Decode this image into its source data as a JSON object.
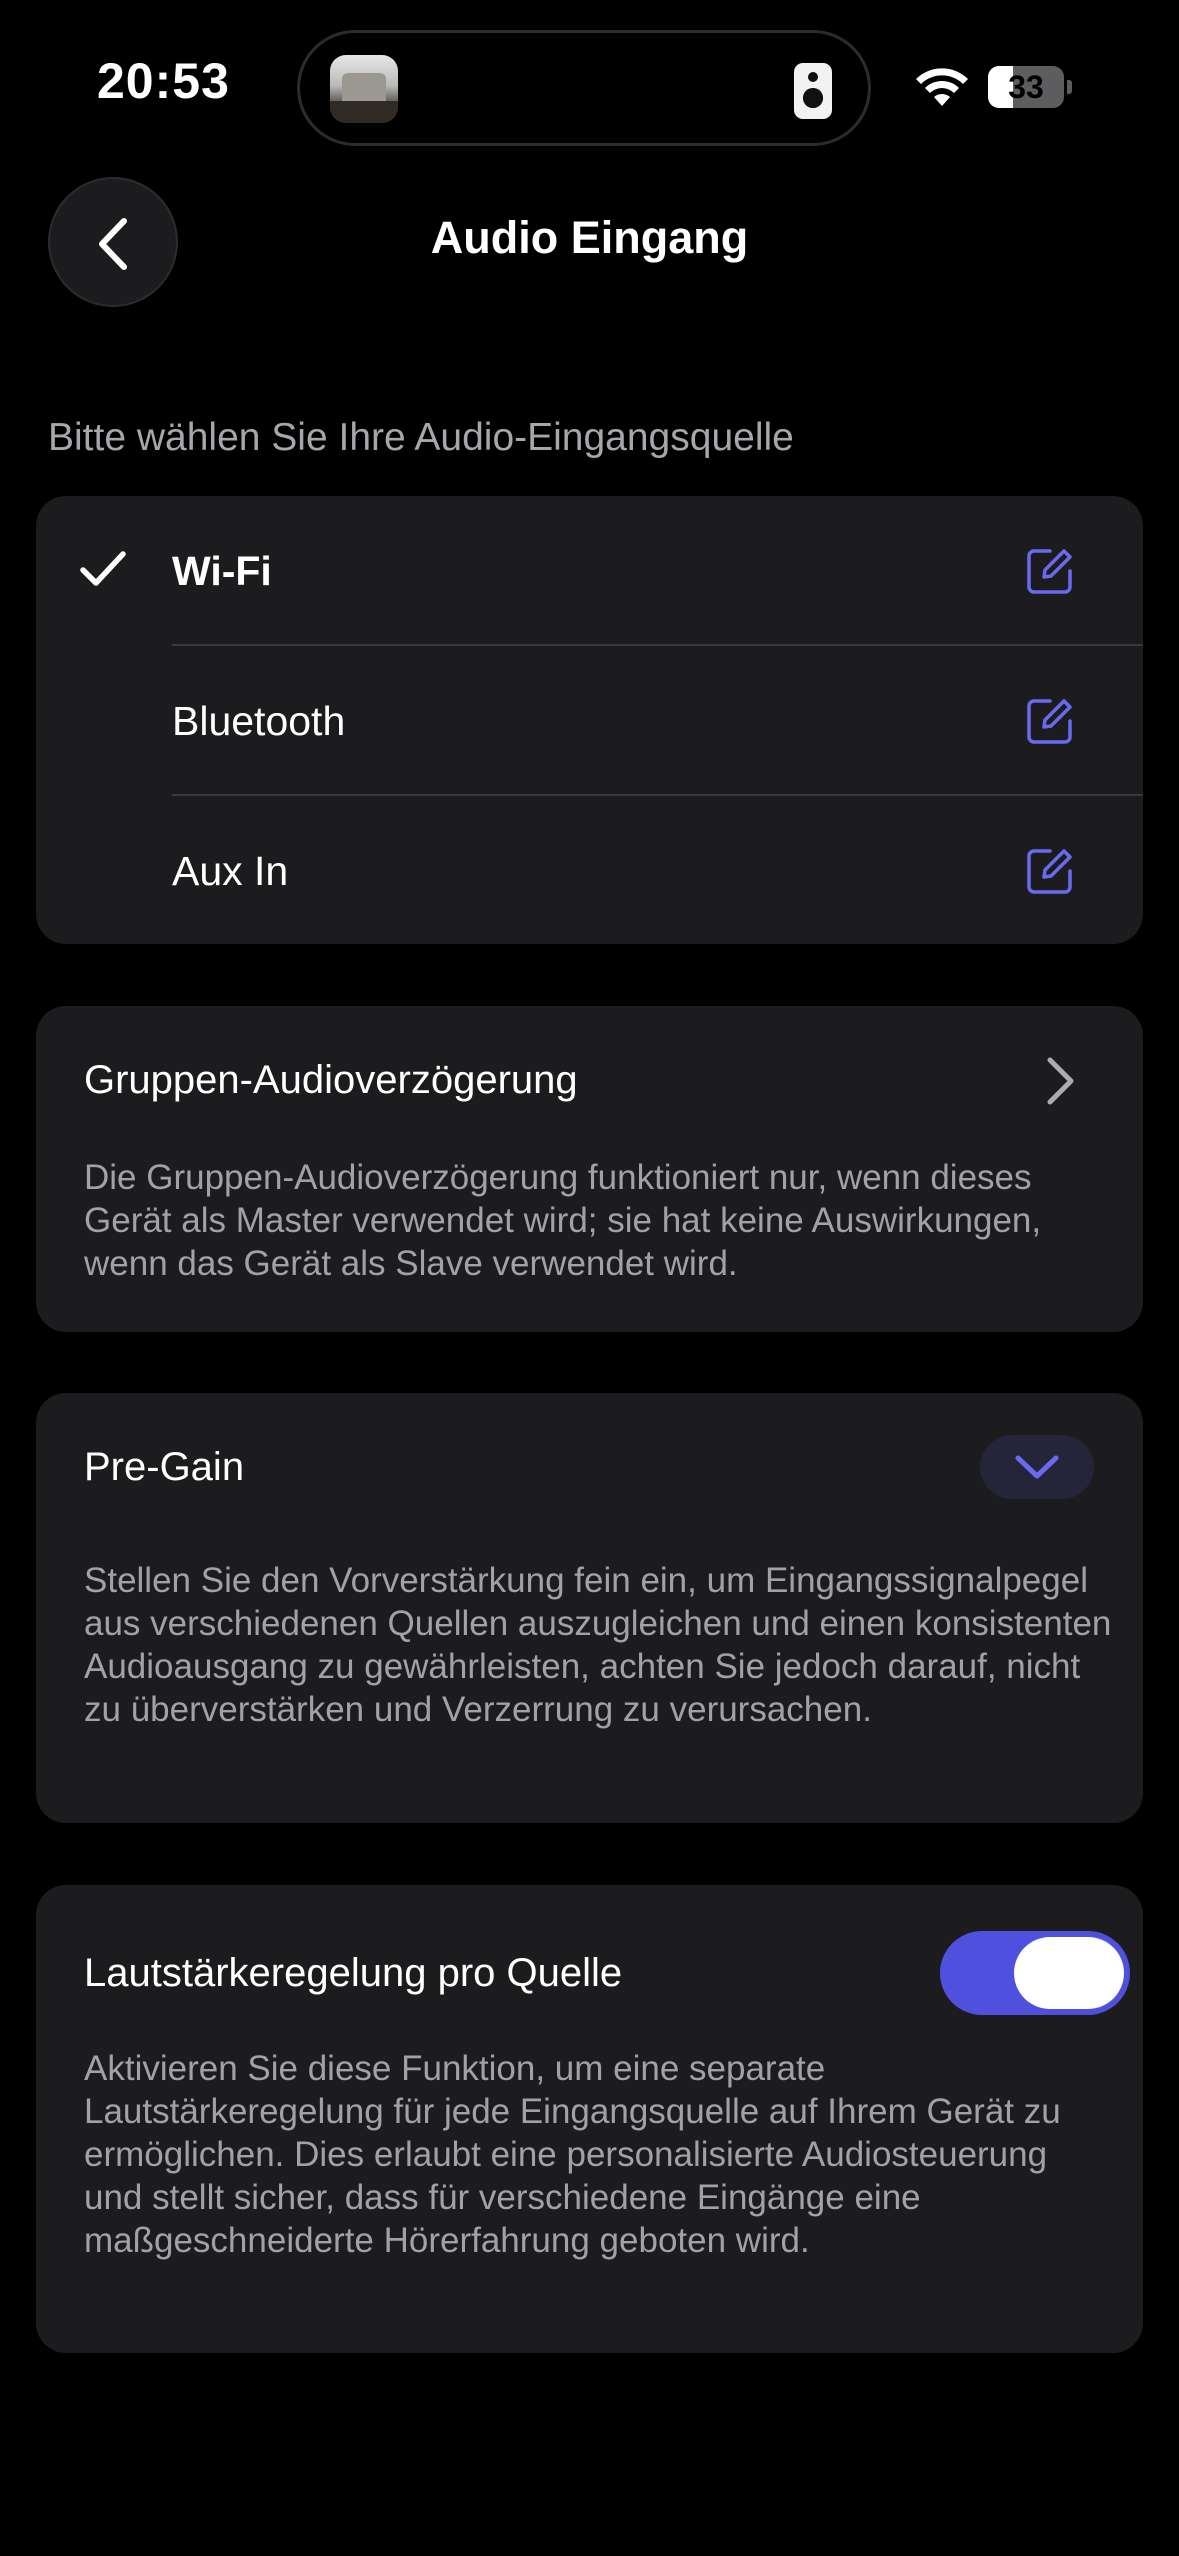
{
  "status_bar": {
    "time": "20:53",
    "battery_level": "33",
    "battery_fraction": 0.33,
    "icons": [
      "album-thumbnail",
      "speaker-icon",
      "wifi-icon",
      "battery-icon"
    ]
  },
  "header": {
    "title": "Audio Eingang",
    "back_icon": "chevron-left-icon"
  },
  "source_section": {
    "label": "Bitte wählen Sie Ihre Audio-Eingangsquelle",
    "sources": [
      {
        "label": "Wi-Fi",
        "selected": true
      },
      {
        "label": "Bluetooth",
        "selected": false
      },
      {
        "label": "Aux In",
        "selected": false
      }
    ],
    "edit_icon": "edit-icon"
  },
  "group_delay": {
    "title": "Gruppen-Audioverzögerung",
    "description": "Die Gruppen-Audioverzögerung funktioniert nur, wenn dieses Gerät als Master verwendet wird; sie hat keine Auswirkungen, wenn das Gerät als Slave verwendet wird."
  },
  "pre_gain": {
    "title": "Pre-Gain",
    "description": "Stellen Sie den Vorverstärkung fein ein, um Eingangssignalpegel aus verschiedenen Quellen auszugleichen und einen konsistenten Audioausgang zu gewährleisten, achten Sie jedoch darauf, nicht zu überverstärken und Verzerrung zu verursachen."
  },
  "volume_per_source": {
    "title": "Lautstärkeregelung pro Quelle",
    "enabled": true,
    "description": "Aktivieren Sie diese Funktion, um eine separate Lautstärkeregelung für jede Eingangsquelle auf Ihrem Gerät zu ermöglichen. Dies erlaubt eine personalisierte Audiosteuerung und stellt sicher, dass für verschiedene Eingänge eine maßgeschneiderte Hörerfahrung geboten wird."
  },
  "colors": {
    "background": "#000000",
    "card": "#1c1c1e",
    "accent": "#5050de",
    "edit_icon": "#6a6af0",
    "secondary_text": "#a1a1a6"
  }
}
